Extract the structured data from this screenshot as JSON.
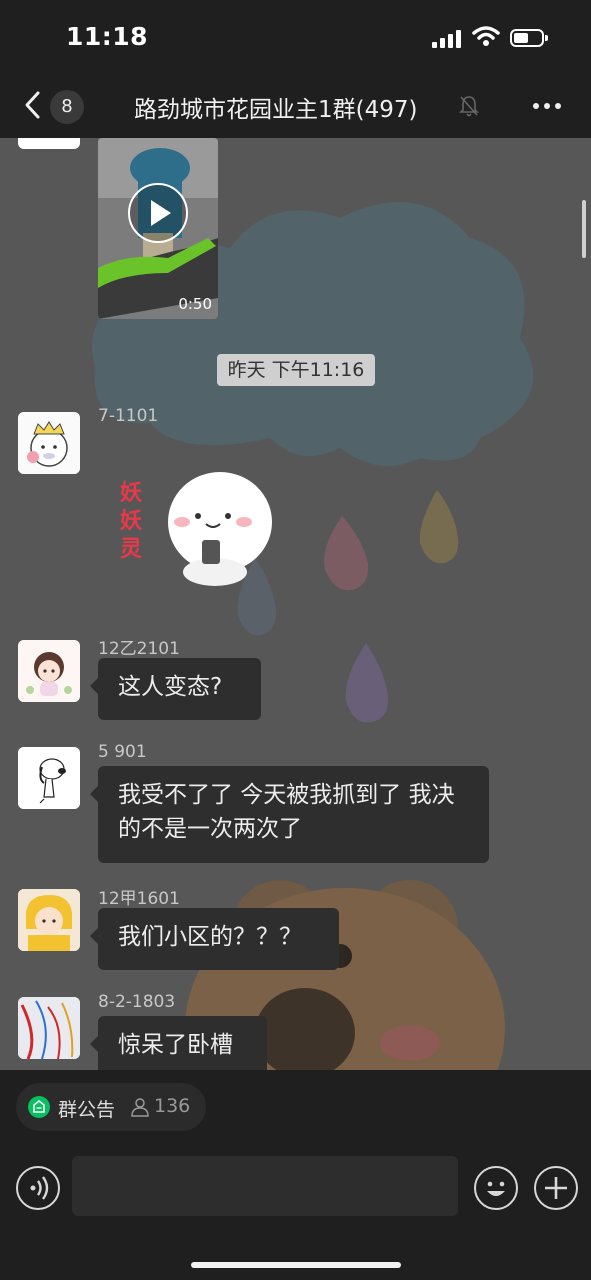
{
  "status": {
    "time": "11:18"
  },
  "nav": {
    "unread_count": "8",
    "title": "路劲城市花园业主1群(497)"
  },
  "chat": {
    "video": {
      "duration": "0:50"
    },
    "timestamp": "昨天 下午11:16",
    "messages": [
      {
        "sender": "7-1101",
        "type": "sticker",
        "sticker_text": "妖妖灵"
      },
      {
        "sender": "12乙2101",
        "text": "这人变态?"
      },
      {
        "sender": "5 901",
        "text": "我受不了了 今天被我抓到了 我决的不是一次两次了"
      },
      {
        "sender": "12甲1601",
        "text": "我们小区的？？？"
      },
      {
        "sender": "8-2-1803",
        "text": "惊呆了卧槽"
      }
    ]
  },
  "bottom": {
    "notice_label": "群公告",
    "member_count": "136"
  },
  "colors": {
    "accent": "#07c160",
    "bubble": "#2e2e2e",
    "chat_bg": "#575757"
  }
}
